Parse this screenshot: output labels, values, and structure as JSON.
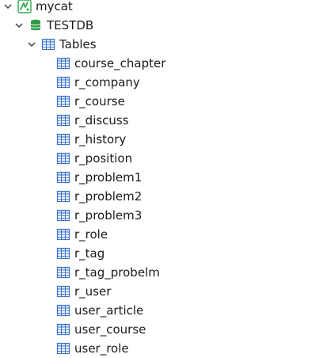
{
  "tree": {
    "connection": {
      "label": "mycat",
      "icon": "mycat-connection-icon",
      "expanded": true
    },
    "database": {
      "label": "TESTDB",
      "icon": "database-icon",
      "expanded": true
    },
    "tables_folder": {
      "label": "Tables",
      "icon": "tables-folder-icon",
      "expanded": true
    },
    "tables": [
      {
        "label": "course_chapter"
      },
      {
        "label": "r_company"
      },
      {
        "label": "r_course"
      },
      {
        "label": "r_discuss"
      },
      {
        "label": "r_history"
      },
      {
        "label": "r_position"
      },
      {
        "label": "r_problem1"
      },
      {
        "label": "r_problem2"
      },
      {
        "label": "r_problem3"
      },
      {
        "label": "r_role"
      },
      {
        "label": "r_tag"
      },
      {
        "label": "r_tag_probelm"
      },
      {
        "label": "r_user"
      },
      {
        "label": "user_article"
      },
      {
        "label": "user_course"
      },
      {
        "label": "user_role"
      }
    ]
  },
  "colors": {
    "chevron": "#555555",
    "connection_green": "#2fa84f",
    "database_green": "#2e9b45",
    "table_blue": "#3a73c9",
    "table_header": "#cfe0f6"
  }
}
